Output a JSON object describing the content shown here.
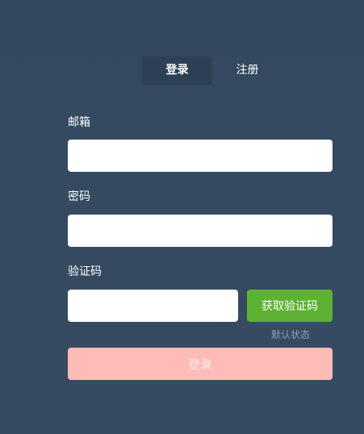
{
  "tabs": [
    {
      "label": "登录",
      "active": true
    },
    {
      "label": "注册",
      "active": false
    }
  ],
  "form": {
    "email_label": "邮箱",
    "email_value": "",
    "password_label": "密码",
    "password_value": "",
    "code_label": "验证码",
    "code_value": "",
    "get_code_label": "获取验证码",
    "status_text": "默认状态",
    "submit_label": "登录"
  },
  "colors": {
    "background": "#354a61",
    "active_tab": "#2e4054",
    "get_code_button": "#5db233",
    "submit_button": "#fdbcb6",
    "input_background": "#ffffff"
  }
}
